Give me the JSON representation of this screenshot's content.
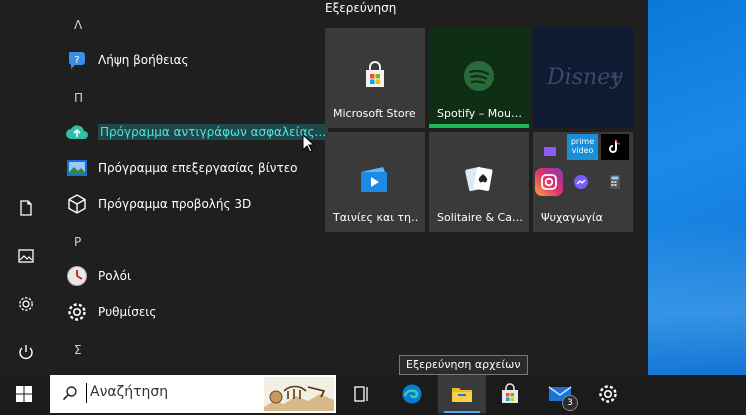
{
  "applist": {
    "sections": [
      {
        "letter": "Λ",
        "items": [
          {
            "label": "Λήψη βοήθειας",
            "icon": "help-icon"
          }
        ]
      },
      {
        "letter": "Π",
        "items": [
          {
            "label": "Πρόγραμμα αντιγράφων ασφαλείας...",
            "icon": "cloud-upload-icon"
          },
          {
            "label": "Πρόγραμμα επεξεργασίας βίντεο",
            "icon": "video-editor-icon"
          },
          {
            "label": "Πρόγραμμα προβολής 3D",
            "icon": "cube-3d-icon"
          }
        ]
      },
      {
        "letter": "Ρ",
        "items": [
          {
            "label": "Ρολόι",
            "icon": "clock-icon"
          },
          {
            "label": "Ρυθμίσεις",
            "icon": "gear-icon"
          }
        ]
      },
      {
        "letter": "Σ",
        "items": []
      }
    ]
  },
  "tiles": {
    "group_title": "Εξερεύνηση",
    "items": [
      {
        "label": "Microsoft Store",
        "icon": "store-icon",
        "bg": "#3a3a3a"
      },
      {
        "label": "Spotify – Mou…",
        "icon": "spotify-icon",
        "bg": "#0f2e16"
      },
      {
        "label": "",
        "icon": "disney-plus-icon",
        "bg": "#0e1b33"
      },
      {
        "label": "Ταινίες και τη…",
        "icon": "movies-tv-icon",
        "bg": "#3a3a3a"
      },
      {
        "label": "Solitaire & Ca…",
        "icon": "cards-icon",
        "bg": "#3a3a3a"
      },
      {
        "label": "Ψυχαγωγία",
        "icon": "entertainment-folder-icon",
        "bg": "#3a3a3a"
      }
    ],
    "folder_mini": {
      "prime_label": "prime video"
    }
  },
  "taskbar": {
    "search_placeholder": "Αναζήτηση",
    "mail_badge": "3"
  },
  "tooltip": {
    "text": "Εξερεύνηση αρχείων"
  },
  "colors": {
    "accent": "#4fe3e3",
    "highlight_bg": "#1f4848",
    "desktop": "#0a78d7"
  }
}
